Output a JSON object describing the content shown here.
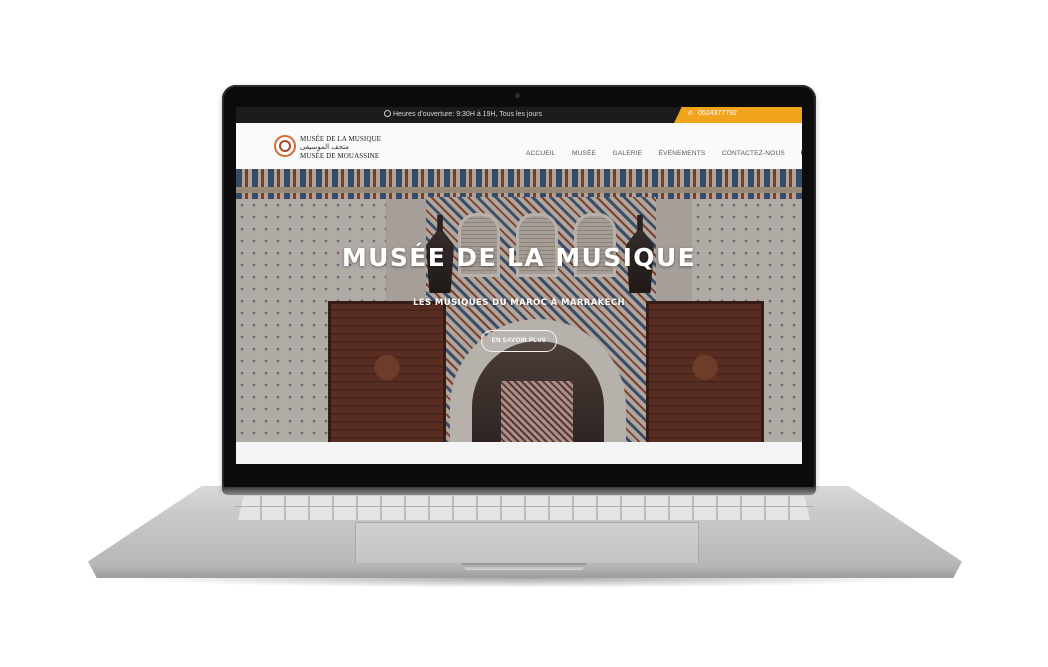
{
  "topbar": {
    "hours_text": "Heures d'ouverture: 9:30H à 19H, Tous les jours",
    "phone": "0524377792",
    "accent_color": "#f0a31b"
  },
  "logo": {
    "line1": "MUSÉE DE LA MUSIQUE",
    "line2": "متحف الموسيقى",
    "line3": "MUSÉE DE MOUASSINE",
    "icon": "museum-emblem-icon"
  },
  "nav": {
    "items": [
      "ACCUEIL",
      "MUSÉE",
      "GALERIE",
      "ÉVÉNEMENTS",
      "CONTACTEZ-NOUS"
    ],
    "search_icon": "search-icon"
  },
  "hero": {
    "title": "MUSÉE DE LA MUSIQUE",
    "subtitle": "LES MUSIQUES DU MAROC À MARRAKECH",
    "button": "EN SAVOIR PLUS"
  }
}
